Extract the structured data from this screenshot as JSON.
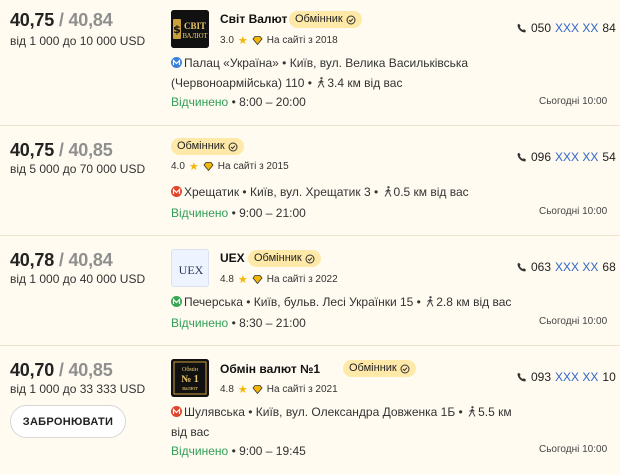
{
  "offers": [
    {
      "buy": "40,75",
      "sell": "40,84",
      "rate_sep": "/",
      "range": "від 1 000 до 10 000 USD",
      "name": "Світ Валют",
      "badge": "Обмінник",
      "rating": "3.0",
      "since": "На сайті з 2018",
      "metro_line": "blue",
      "address": "Палац «Україна» • Київ, вул. Велика Васильківська (Червоноармійська) 110 •",
      "distance": "3.4 км від вас",
      "status": "Відчинено",
      "hours": "• 8:00 – 20:00",
      "phone_prefix": "050",
      "phone_hidden": "XXX XX",
      "phone_suffix": "84",
      "updated": "Сьогодні 10:00",
      "logo": {
        "line1": "СВІТ",
        "line2": "ВАЛЮТ"
      }
    },
    {
      "buy": "40,75",
      "sell": "40,85",
      "rate_sep": "/",
      "range": "від 5 000 до 70 000 USD",
      "name": "",
      "badge": "Обмінник",
      "rating": "4.0",
      "since": "На сайті з 2015",
      "metro_line": "red",
      "address": "Хрещатик • Київ, вул. Хрещатик 3 •",
      "distance": "0.5 км від вас",
      "status": "Відчинено",
      "hours": "• 9:00 – 21:00",
      "phone_prefix": "096",
      "phone_hidden": "XXX XX",
      "phone_suffix": "54",
      "updated": "Сьогодні 10:00"
    },
    {
      "buy": "40,78",
      "sell": "40,84",
      "rate_sep": "/",
      "range": "від 1 000 до 40 000 USD",
      "name": "UEX",
      "badge": "Обмінник",
      "rating": "4.8",
      "since": "На сайті з 2022",
      "metro_line": "green",
      "address": "Печерська • Київ, бульв. Лесі Українки 15 •",
      "distance": "2.8 км від вас",
      "status": "Відчинено",
      "hours": "• 8:30 – 21:00",
      "phone_prefix": "063",
      "phone_hidden": "XXX XX",
      "phone_suffix": "68",
      "updated": "Сьогодні 10:00",
      "logo": {
        "line1": "UEX"
      }
    },
    {
      "buy": "40,70",
      "sell": "40,85",
      "rate_sep": "/",
      "range": "від 1 000 до 33 333 USD",
      "name": "Обмін валют №1",
      "badge": "Обмінник",
      "rating": "4.8",
      "since": "На сайті з 2021",
      "metro_line": "red",
      "address": "Шулявська • Київ, вул. Олександра Довженка 1Б •",
      "distance": "5.5 км від вас",
      "status": "Відчинено",
      "hours": "• 9:00 – 19:45",
      "phone_prefix": "093",
      "phone_hidden": "XXX XX",
      "phone_suffix": "10",
      "updated": "Сьогодні 10:00",
      "book_label": "ЗАБРОНЮВАТИ",
      "logo": {
        "line1": "Обмін",
        "line2": "№ 1",
        "line3": "валют"
      }
    }
  ],
  "colors": {
    "background": "#fffbf0",
    "badge": "#ffe9a8",
    "open": "#2f9e57",
    "phone_hidden": "#2f65c8",
    "metro_blue": "#3d7fd8",
    "metro_red": "#e0442c",
    "metro_green": "#3aa555",
    "star": "#f2b705"
  },
  "icons": [
    "metro-icon",
    "walk-icon",
    "phone-icon",
    "star-icon",
    "diamond-icon",
    "check-icon"
  ]
}
